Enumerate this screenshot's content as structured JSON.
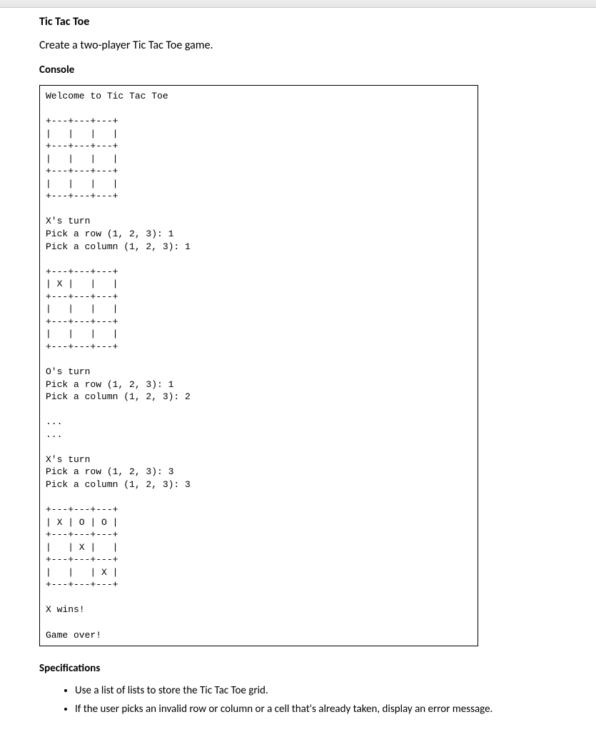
{
  "title": "Tic Tac Toe",
  "description": "Create a two-player Tic Tac Toe game.",
  "console_heading": "Console",
  "console_output": "Welcome to Tic Tac Toe\n\n+---+---+---+\n|   |   |   |\n+---+---+---+\n|   |   |   |\n+---+---+---+\n|   |   |   |\n+---+---+---+\n\nX's turn\nPick a row (1, 2, 3): 1\nPick a column (1, 2, 3): 1\n\n+---+---+---+\n| X |   |   |\n+---+---+---+\n|   |   |   |\n+---+---+---+\n|   |   |   |\n+---+---+---+\n\nO's turn\nPick a row (1, 2, 3): 1\nPick a column (1, 2, 3): 2\n\n...\n...\n\nX's turn\nPick a row (1, 2, 3): 3\nPick a column (1, 2, 3): 3\n\n+---+---+---+\n| X | O | O |\n+---+---+---+\n|   | X |   |\n+---+---+---+\n|   |   | X |\n+---+---+---+\n\nX wins!\n\nGame over!",
  "specs_heading": "Specifications",
  "specs": {
    "items": [
      "Use a list of lists to store the Tic Tac Toe grid.",
      "If the user picks an invalid row or column or a cell that's already taken, display an error message."
    ]
  }
}
